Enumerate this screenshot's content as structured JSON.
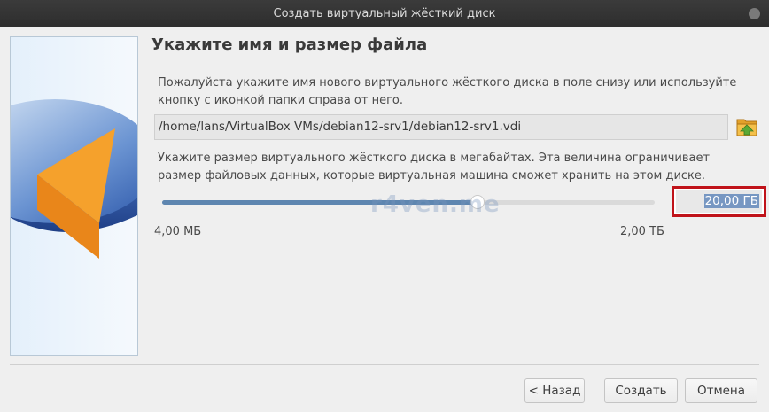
{
  "window": {
    "title": "Создать виртуальный жёсткий диск"
  },
  "page": {
    "heading": "Укажите имя и размер файла",
    "name_hint_line1": "Пожалуйста укажите имя нового виртуального жёсткого диска в поле снизу или используйте",
    "name_hint_line2": "кнопку с иконкой папки справа от него.",
    "file_path": "/home/lans/VirtualBox VMs/debian12-srv1/debian12-srv1.vdi",
    "size_hint_line1": "Укажите размер виртуального жёсткого диска в мегабайтах. Эта величина ограничивает",
    "size_hint_line2": "размер файловых данных, которые виртуальная машина сможет хранить на этом диске."
  },
  "slider": {
    "min_label": "4,00 МБ",
    "max_label": "2,00 ТБ",
    "position_fraction": 0.64,
    "size_value": "20,00 ГБ"
  },
  "watermark": "r4ven.me",
  "buttons": {
    "back": "< Назад",
    "create": "Создать",
    "cancel": "Отмена"
  },
  "icons": {
    "folder": "folder-open-icon",
    "close": "close-icon",
    "side_image": "hard-disk-pie-icon"
  },
  "colors": {
    "accent": "#5e86b0",
    "highlight_border": "#c0131a",
    "selection": "#7797c2"
  }
}
